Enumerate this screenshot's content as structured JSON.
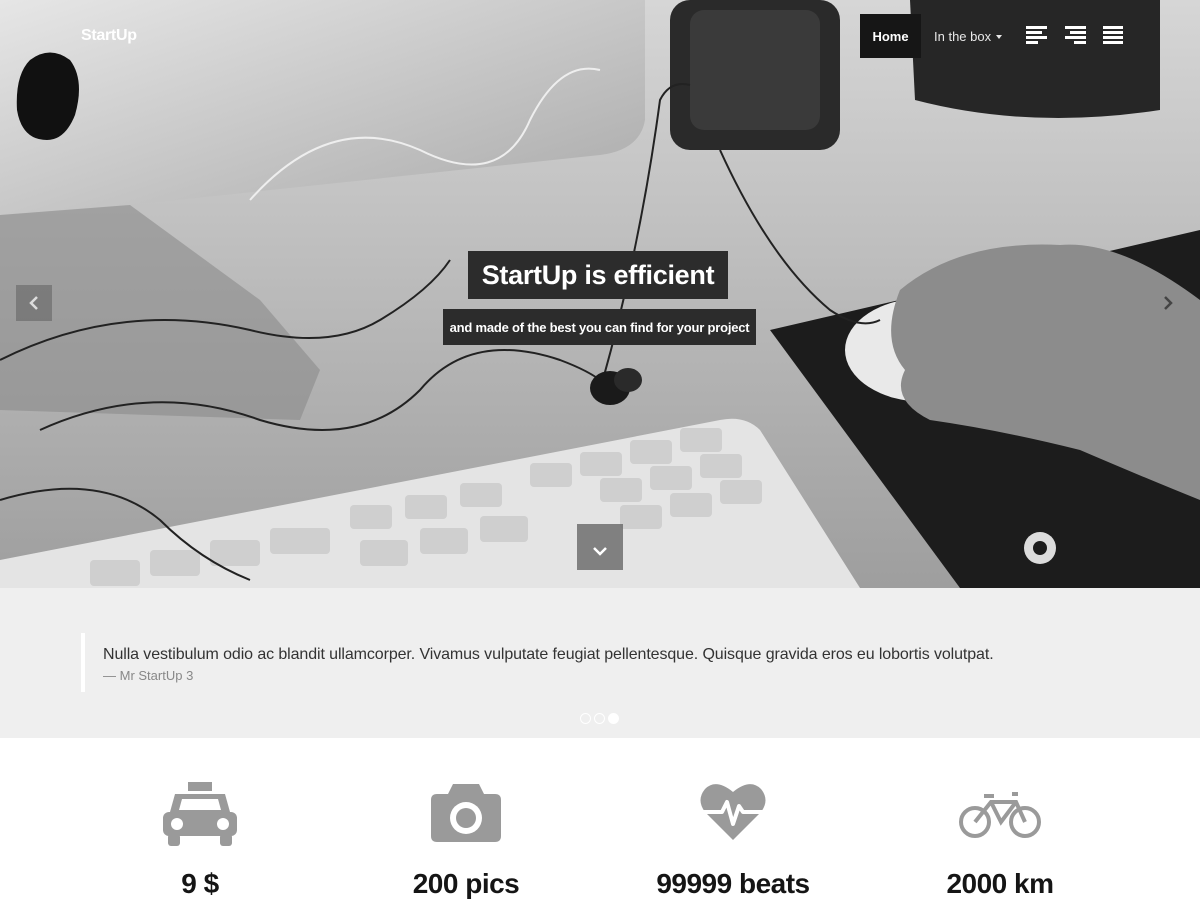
{
  "nav": {
    "brand": "StartUp",
    "home_label": "Home",
    "in_the_box_label": "In the box",
    "icons": [
      "align-left-icon",
      "align-right-icon",
      "align-justify-icon"
    ]
  },
  "hero": {
    "title": "StartUp is efficient",
    "subtitle": "and made of the best you can find for your project",
    "icons": [
      "chevron-left-icon",
      "chevron-right-icon",
      "chevron-down-icon"
    ]
  },
  "testimonial": {
    "quote": "Nulla vestibulum odio ac blandit ullamcorper. Vivamus vulputate feugiat pellentesque. Quisque gravida eros eu lobortis volutpat.",
    "author": "— Mr StartUp 3",
    "dots_total": 3,
    "dots_active": 3
  },
  "stats": [
    {
      "icon": "taxi-icon",
      "value": "9 $"
    },
    {
      "icon": "camera-icon",
      "value": "200 pics"
    },
    {
      "icon": "heartbeat-icon",
      "value": "99999 beats"
    },
    {
      "icon": "bicycle-icon",
      "value": "2000 km"
    }
  ],
  "colors": {
    "nav_active_bg": "#161616",
    "caption_bg": "#2c2c2c",
    "quote_bg": "#efefef",
    "stat_icon": "#9a9a9a",
    "stat_text": "#151515"
  }
}
